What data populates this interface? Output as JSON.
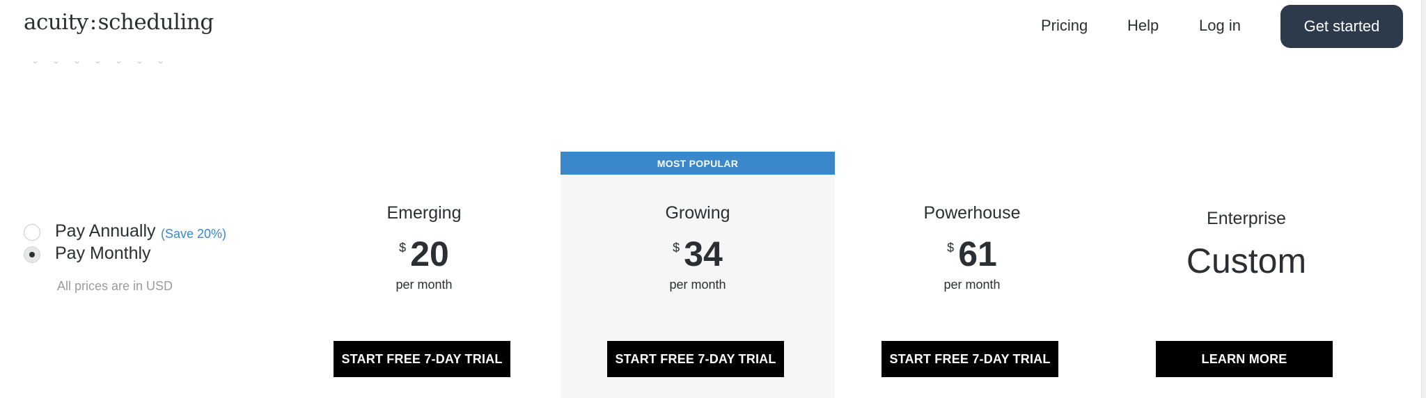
{
  "header": {
    "logo_left": "acuity",
    "logo_sep": ":",
    "logo_right": "scheduling",
    "nav": {
      "pricing": "Pricing",
      "help": "Help",
      "login": "Log in"
    },
    "cta": "Get started"
  },
  "billing": {
    "annual_label": "Pay Annually",
    "annual_save": "(Save 20%)",
    "monthly_label": "Pay Monthly",
    "selected": "monthly",
    "currency_note": "All prices are in USD"
  },
  "plans": [
    {
      "name": "Emerging",
      "currency": "$",
      "price": "20",
      "period": "per month",
      "cta": "START FREE 7-DAY TRIAL"
    },
    {
      "name": "Growing",
      "badge": "MOST POPULAR",
      "currency": "$",
      "price": "34",
      "period": "per month",
      "cta": "START FREE 7-DAY TRIAL"
    },
    {
      "name": "Powerhouse",
      "currency": "$",
      "price": "61",
      "period": "per month",
      "cta": "START FREE 7-DAY TRIAL"
    },
    {
      "name": "Enterprise",
      "price_text": "Custom",
      "cta": "LEARN MORE"
    }
  ],
  "colors": {
    "accent": "#3a87c9",
    "header_button": "#2c3a4b",
    "cta_background": "#000000",
    "popular_column": "#f6f6f6"
  }
}
